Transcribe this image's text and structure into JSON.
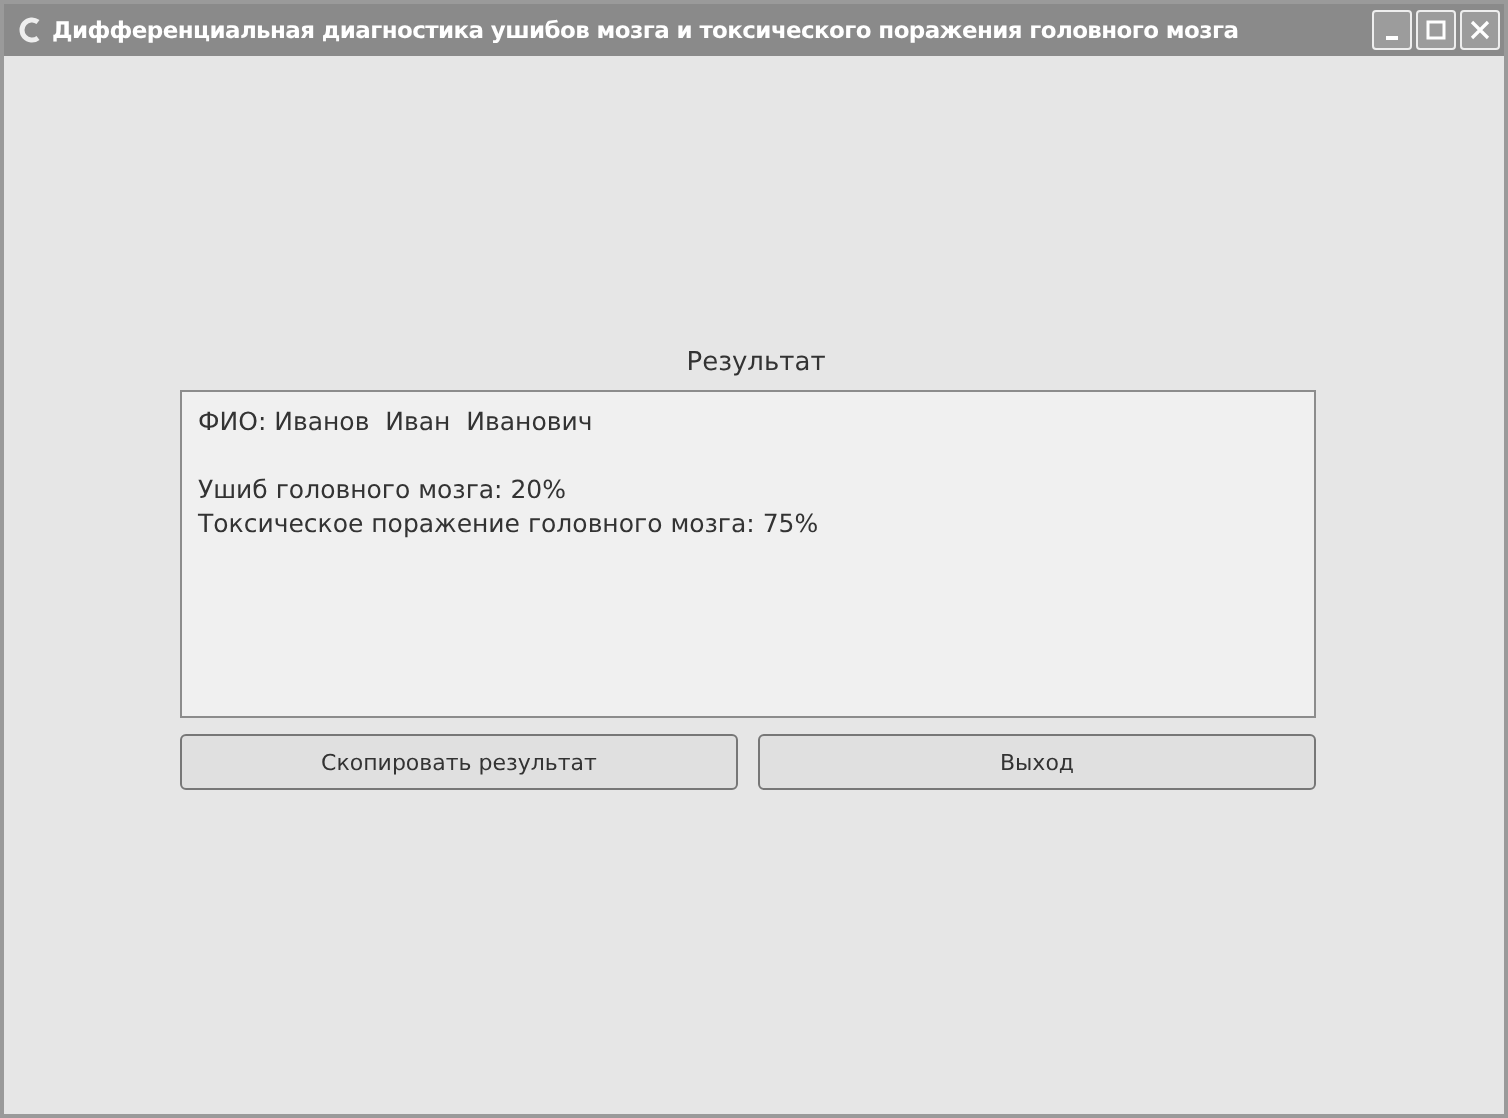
{
  "window": {
    "title": "Дифференциальная диагностика ушибов мозга и токсического поражения головного мозга"
  },
  "result": {
    "heading": "Результат",
    "patient": "ФИО: Иванов  Иван  Иванович",
    "lines": [
      "Ушиб головного мозга: 20%",
      "Токсическое поражение головного мозга: 75%"
    ]
  },
  "buttons": [
    "Скопировать результат",
    "Выход"
  ]
}
